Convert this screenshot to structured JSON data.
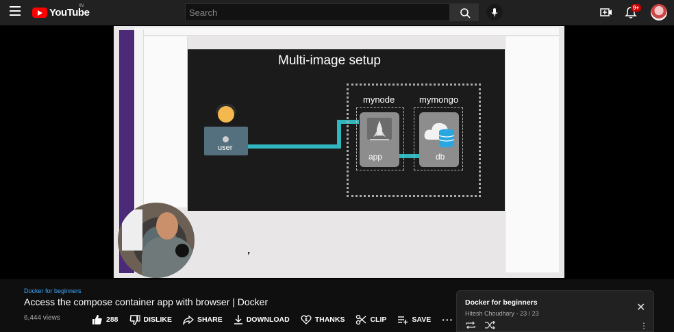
{
  "header": {
    "logo_text": "YouTube",
    "country_code": "IN",
    "search_placeholder": "Search",
    "notification_count": "9+"
  },
  "slide": {
    "title": "Multi-image setup",
    "user_label": "user",
    "node_label": "mynode",
    "mongo_label": "mymongo",
    "app_label": "app",
    "db_label": "db",
    "wire_color": "#2fb6bf"
  },
  "video": {
    "playlist_name": "Docker for beginners",
    "title": "Access the compose container app with browser | Docker",
    "views": "6,444 views",
    "actions": {
      "likes": "288",
      "dislike": "DISLIKE",
      "share": "SHARE",
      "download": "DOWNLOAD",
      "thanks": "THANKS",
      "clip": "CLIP",
      "save": "SAVE"
    }
  },
  "playlist_panel": {
    "title": "Docker for beginners",
    "author": "Hitesh Choudhary",
    "position": "23 / 23"
  },
  "colors": {
    "youtube_red": "#ff0000",
    "link_blue": "#3ea6ff",
    "figma_purple": "#4b2a78"
  }
}
